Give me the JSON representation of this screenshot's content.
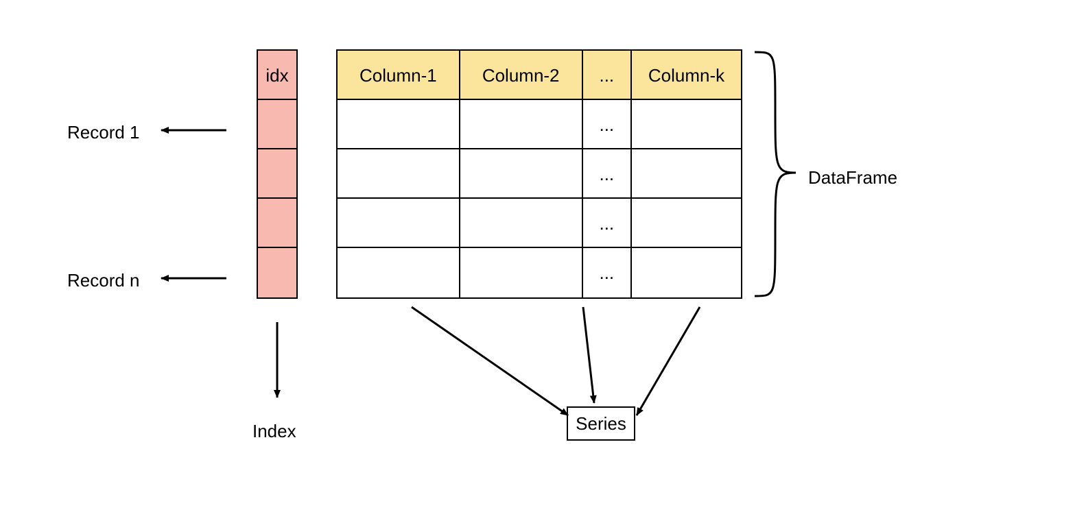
{
  "labels": {
    "record1": "Record 1",
    "recordn": "Record n",
    "index": "Index",
    "dataframe": "DataFrame",
    "series": "Series"
  },
  "idx": {
    "header": "idx",
    "rows": [
      "",
      "",
      "",
      ""
    ]
  },
  "df": {
    "headers": [
      "Column-1",
      "Column-2",
      "...",
      "Column-k"
    ],
    "rows": [
      [
        "",
        "",
        "...",
        ""
      ],
      [
        "",
        "",
        "...",
        ""
      ],
      [
        "",
        "",
        "...",
        ""
      ],
      [
        "",
        "",
        "...",
        ""
      ]
    ]
  },
  "colors": {
    "idx_fill": "#f7b9b0",
    "header_fill": "#fbe59c"
  }
}
